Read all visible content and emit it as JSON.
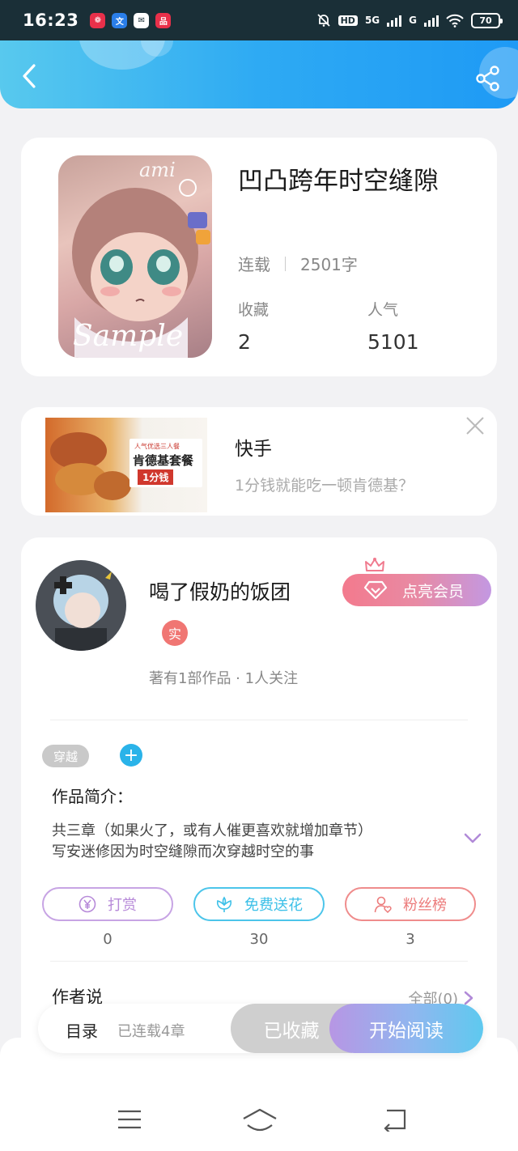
{
  "status_bar": {
    "time": "16:23",
    "apps": [
      {
        "icon": "red-gift-icon",
        "color": "#e8304a",
        "glyph": "❁"
      },
      {
        "icon": "translate-app-icon",
        "color": "#2a7ee8",
        "glyph": "文"
      },
      {
        "icon": "mail-app-icon",
        "color": "#ffffff",
        "glyph": "✉"
      },
      {
        "icon": "shop-app-icon",
        "color": "#e8304a",
        "glyph": "品"
      }
    ],
    "hd": "HD",
    "network": "5G",
    "network2": "G",
    "battery": "70"
  },
  "header": {
    "back_icon": "chevron-left-icon",
    "share_icon": "share-icon",
    "accent": "#2eaaf3"
  },
  "book": {
    "title": "凹凸跨年时空缝隙",
    "cover_text_top": "ami",
    "cover_text_sample": "Sample",
    "status": "连载",
    "word_count": "2501字",
    "favorites_label": "收藏",
    "favorites_value": "2",
    "popularity_label": "人气",
    "popularity_value": "5101"
  },
  "ad": {
    "title": "快手",
    "description": "1分钱就能吃一顿肯德基？",
    "image_subtitle": "人气优选三人餐",
    "image_main": "肯德基套餐",
    "image_price": "1分钱",
    "close_icon": "close-icon"
  },
  "author": {
    "name": "喝了假奶的饭团",
    "badge": "实",
    "meta": "著有1部作品 · 1人关注",
    "member_button": "点亮会员"
  },
  "tags": {
    "items": [
      "穿越"
    ],
    "add_label": "+"
  },
  "intro": {
    "title": "作品简介：",
    "lines": [
      "共三章（如果火了，或有人催更喜欢就增加章节）",
      "写安迷修因为时空缝隙而次穿越时空的事"
    ]
  },
  "actions": [
    {
      "label": "打赏",
      "count": "0",
      "icon": "yen-coin-icon",
      "color": "#b78ad9"
    },
    {
      "label": "免费送花",
      "count": "30",
      "icon": "flower-icon",
      "color": "#3cc0e8"
    },
    {
      "label": "粉丝榜",
      "count": "3",
      "icon": "user-heart-icon",
      "color": "#ec7b7b"
    }
  ],
  "author_say": {
    "title": "作者说",
    "all_label": "全部(0)"
  },
  "bottom_bar": {
    "catalog": "目录",
    "serial": "已连载4章",
    "collected": "已收藏",
    "read": "开始阅读"
  },
  "nav": {
    "menu_icon": "menu-icon",
    "home_icon": "home-icon",
    "back_icon": "back-icon"
  }
}
